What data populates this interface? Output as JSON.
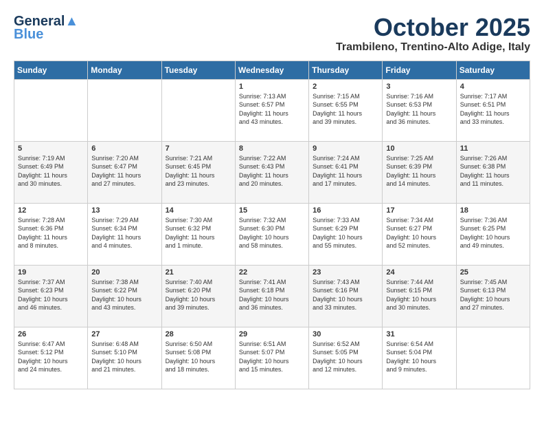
{
  "logo": {
    "line1": "General",
    "line2": "Blue"
  },
  "title": "October 2025",
  "location": "Trambileno, Trentino-Alto Adige, Italy",
  "days_of_week": [
    "Sunday",
    "Monday",
    "Tuesday",
    "Wednesday",
    "Thursday",
    "Friday",
    "Saturday"
  ],
  "weeks": [
    [
      {
        "day": "",
        "info": ""
      },
      {
        "day": "",
        "info": ""
      },
      {
        "day": "",
        "info": ""
      },
      {
        "day": "1",
        "info": "Sunrise: 7:13 AM\nSunset: 6:57 PM\nDaylight: 11 hours\nand 43 minutes."
      },
      {
        "day": "2",
        "info": "Sunrise: 7:15 AM\nSunset: 6:55 PM\nDaylight: 11 hours\nand 39 minutes."
      },
      {
        "day": "3",
        "info": "Sunrise: 7:16 AM\nSunset: 6:53 PM\nDaylight: 11 hours\nand 36 minutes."
      },
      {
        "day": "4",
        "info": "Sunrise: 7:17 AM\nSunset: 6:51 PM\nDaylight: 11 hours\nand 33 minutes."
      }
    ],
    [
      {
        "day": "5",
        "info": "Sunrise: 7:19 AM\nSunset: 6:49 PM\nDaylight: 11 hours\nand 30 minutes."
      },
      {
        "day": "6",
        "info": "Sunrise: 7:20 AM\nSunset: 6:47 PM\nDaylight: 11 hours\nand 27 minutes."
      },
      {
        "day": "7",
        "info": "Sunrise: 7:21 AM\nSunset: 6:45 PM\nDaylight: 11 hours\nand 23 minutes."
      },
      {
        "day": "8",
        "info": "Sunrise: 7:22 AM\nSunset: 6:43 PM\nDaylight: 11 hours\nand 20 minutes."
      },
      {
        "day": "9",
        "info": "Sunrise: 7:24 AM\nSunset: 6:41 PM\nDaylight: 11 hours\nand 17 minutes."
      },
      {
        "day": "10",
        "info": "Sunrise: 7:25 AM\nSunset: 6:39 PM\nDaylight: 11 hours\nand 14 minutes."
      },
      {
        "day": "11",
        "info": "Sunrise: 7:26 AM\nSunset: 6:38 PM\nDaylight: 11 hours\nand 11 minutes."
      }
    ],
    [
      {
        "day": "12",
        "info": "Sunrise: 7:28 AM\nSunset: 6:36 PM\nDaylight: 11 hours\nand 8 minutes."
      },
      {
        "day": "13",
        "info": "Sunrise: 7:29 AM\nSunset: 6:34 PM\nDaylight: 11 hours\nand 4 minutes."
      },
      {
        "day": "14",
        "info": "Sunrise: 7:30 AM\nSunset: 6:32 PM\nDaylight: 11 hours\nand 1 minute."
      },
      {
        "day": "15",
        "info": "Sunrise: 7:32 AM\nSunset: 6:30 PM\nDaylight: 10 hours\nand 58 minutes."
      },
      {
        "day": "16",
        "info": "Sunrise: 7:33 AM\nSunset: 6:29 PM\nDaylight: 10 hours\nand 55 minutes."
      },
      {
        "day": "17",
        "info": "Sunrise: 7:34 AM\nSunset: 6:27 PM\nDaylight: 10 hours\nand 52 minutes."
      },
      {
        "day": "18",
        "info": "Sunrise: 7:36 AM\nSunset: 6:25 PM\nDaylight: 10 hours\nand 49 minutes."
      }
    ],
    [
      {
        "day": "19",
        "info": "Sunrise: 7:37 AM\nSunset: 6:23 PM\nDaylight: 10 hours\nand 46 minutes."
      },
      {
        "day": "20",
        "info": "Sunrise: 7:38 AM\nSunset: 6:22 PM\nDaylight: 10 hours\nand 43 minutes."
      },
      {
        "day": "21",
        "info": "Sunrise: 7:40 AM\nSunset: 6:20 PM\nDaylight: 10 hours\nand 39 minutes."
      },
      {
        "day": "22",
        "info": "Sunrise: 7:41 AM\nSunset: 6:18 PM\nDaylight: 10 hours\nand 36 minutes."
      },
      {
        "day": "23",
        "info": "Sunrise: 7:43 AM\nSunset: 6:16 PM\nDaylight: 10 hours\nand 33 minutes."
      },
      {
        "day": "24",
        "info": "Sunrise: 7:44 AM\nSunset: 6:15 PM\nDaylight: 10 hours\nand 30 minutes."
      },
      {
        "day": "25",
        "info": "Sunrise: 7:45 AM\nSunset: 6:13 PM\nDaylight: 10 hours\nand 27 minutes."
      }
    ],
    [
      {
        "day": "26",
        "info": "Sunrise: 6:47 AM\nSunset: 5:12 PM\nDaylight: 10 hours\nand 24 minutes."
      },
      {
        "day": "27",
        "info": "Sunrise: 6:48 AM\nSunset: 5:10 PM\nDaylight: 10 hours\nand 21 minutes."
      },
      {
        "day": "28",
        "info": "Sunrise: 6:50 AM\nSunset: 5:08 PM\nDaylight: 10 hours\nand 18 minutes."
      },
      {
        "day": "29",
        "info": "Sunrise: 6:51 AM\nSunset: 5:07 PM\nDaylight: 10 hours\nand 15 minutes."
      },
      {
        "day": "30",
        "info": "Sunrise: 6:52 AM\nSunset: 5:05 PM\nDaylight: 10 hours\nand 12 minutes."
      },
      {
        "day": "31",
        "info": "Sunrise: 6:54 AM\nSunset: 5:04 PM\nDaylight: 10 hours\nand 9 minutes."
      },
      {
        "day": "",
        "info": ""
      }
    ]
  ]
}
